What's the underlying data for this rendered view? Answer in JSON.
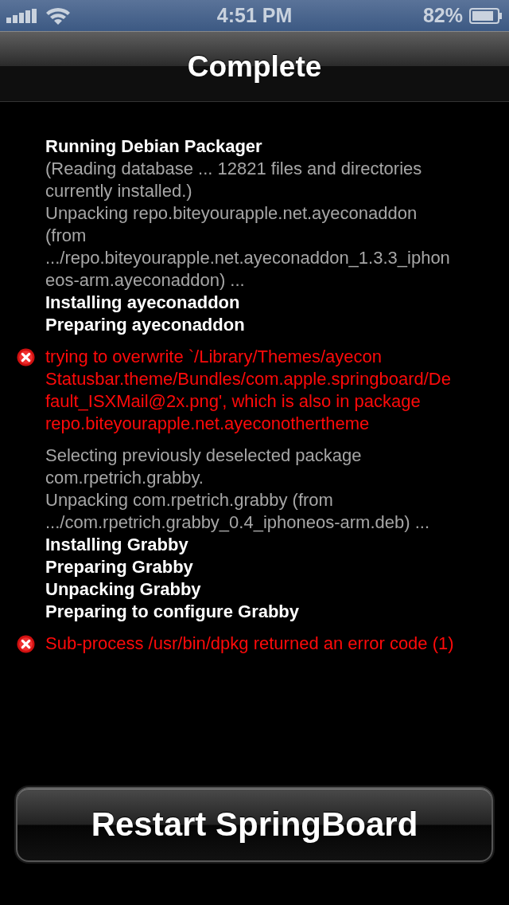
{
  "status_bar": {
    "time": "4:51 PM",
    "battery": "82%"
  },
  "nav_bar": {
    "title": "Complete"
  },
  "log": [
    {
      "kind": "status",
      "text": "Running Debian Packager"
    },
    {
      "kind": "info",
      "text": "(Reading database ... 12821 files and directories\ncurrently installed.)\nUnpacking repo.biteyourapple.net.ayeconaddon\n(from\n.../repo.biteyourapple.net.ayeconaddon_1.3.3_iphon\neos-arm.ayeconaddon) ..."
    },
    {
      "kind": "status",
      "text": "Installing ayeconaddon"
    },
    {
      "kind": "status",
      "text": "Preparing ayeconaddon"
    },
    {
      "kind": "error",
      "text": "trying to overwrite `/Library/Themes/ayecon\nStatusbar.theme/Bundles/com.apple.springboard/De\nfault_ISXMail@2x.png', which is also in package\nrepo.biteyourapple.net.ayeconothertheme"
    },
    {
      "kind": "info",
      "text": "Selecting previously deselected package\ncom.rpetrich.grabby.\nUnpacking com.rpetrich.grabby (from\n.../com.rpetrich.grabby_0.4_iphoneos-arm.deb) ..."
    },
    {
      "kind": "status",
      "text": "Installing Grabby"
    },
    {
      "kind": "status",
      "text": "Preparing Grabby"
    },
    {
      "kind": "status",
      "text": "Unpacking Grabby"
    },
    {
      "kind": "status",
      "text": "Preparing to configure Grabby"
    },
    {
      "kind": "error",
      "text": "Sub-process /usr/bin/dpkg returned an error code (1)"
    }
  ],
  "button": {
    "label": "Restart SpringBoard"
  }
}
